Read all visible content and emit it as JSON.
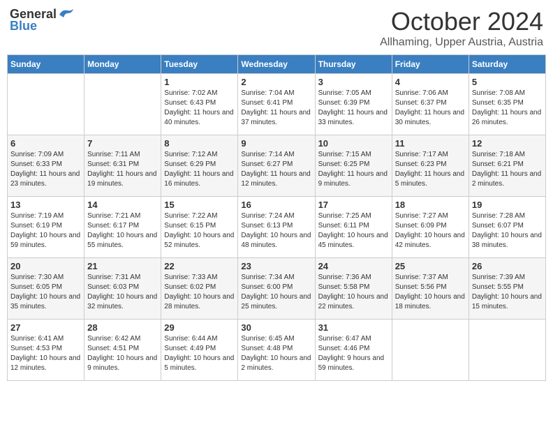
{
  "header": {
    "logo_general": "General",
    "logo_blue": "Blue",
    "title": "October 2024",
    "subtitle": "Allhaming, Upper Austria, Austria"
  },
  "days_of_week": [
    "Sunday",
    "Monday",
    "Tuesday",
    "Wednesday",
    "Thursday",
    "Friday",
    "Saturday"
  ],
  "weeks": [
    [
      {
        "num": "",
        "info": ""
      },
      {
        "num": "",
        "info": ""
      },
      {
        "num": "1",
        "info": "Sunrise: 7:02 AM\nSunset: 6:43 PM\nDaylight: 11 hours and 40 minutes."
      },
      {
        "num": "2",
        "info": "Sunrise: 7:04 AM\nSunset: 6:41 PM\nDaylight: 11 hours and 37 minutes."
      },
      {
        "num": "3",
        "info": "Sunrise: 7:05 AM\nSunset: 6:39 PM\nDaylight: 11 hours and 33 minutes."
      },
      {
        "num": "4",
        "info": "Sunrise: 7:06 AM\nSunset: 6:37 PM\nDaylight: 11 hours and 30 minutes."
      },
      {
        "num": "5",
        "info": "Sunrise: 7:08 AM\nSunset: 6:35 PM\nDaylight: 11 hours and 26 minutes."
      }
    ],
    [
      {
        "num": "6",
        "info": "Sunrise: 7:09 AM\nSunset: 6:33 PM\nDaylight: 11 hours and 23 minutes."
      },
      {
        "num": "7",
        "info": "Sunrise: 7:11 AM\nSunset: 6:31 PM\nDaylight: 11 hours and 19 minutes."
      },
      {
        "num": "8",
        "info": "Sunrise: 7:12 AM\nSunset: 6:29 PM\nDaylight: 11 hours and 16 minutes."
      },
      {
        "num": "9",
        "info": "Sunrise: 7:14 AM\nSunset: 6:27 PM\nDaylight: 11 hours and 12 minutes."
      },
      {
        "num": "10",
        "info": "Sunrise: 7:15 AM\nSunset: 6:25 PM\nDaylight: 11 hours and 9 minutes."
      },
      {
        "num": "11",
        "info": "Sunrise: 7:17 AM\nSunset: 6:23 PM\nDaylight: 11 hours and 5 minutes."
      },
      {
        "num": "12",
        "info": "Sunrise: 7:18 AM\nSunset: 6:21 PM\nDaylight: 11 hours and 2 minutes."
      }
    ],
    [
      {
        "num": "13",
        "info": "Sunrise: 7:19 AM\nSunset: 6:19 PM\nDaylight: 10 hours and 59 minutes."
      },
      {
        "num": "14",
        "info": "Sunrise: 7:21 AM\nSunset: 6:17 PM\nDaylight: 10 hours and 55 minutes."
      },
      {
        "num": "15",
        "info": "Sunrise: 7:22 AM\nSunset: 6:15 PM\nDaylight: 10 hours and 52 minutes."
      },
      {
        "num": "16",
        "info": "Sunrise: 7:24 AM\nSunset: 6:13 PM\nDaylight: 10 hours and 48 minutes."
      },
      {
        "num": "17",
        "info": "Sunrise: 7:25 AM\nSunset: 6:11 PM\nDaylight: 10 hours and 45 minutes."
      },
      {
        "num": "18",
        "info": "Sunrise: 7:27 AM\nSunset: 6:09 PM\nDaylight: 10 hours and 42 minutes."
      },
      {
        "num": "19",
        "info": "Sunrise: 7:28 AM\nSunset: 6:07 PM\nDaylight: 10 hours and 38 minutes."
      }
    ],
    [
      {
        "num": "20",
        "info": "Sunrise: 7:30 AM\nSunset: 6:05 PM\nDaylight: 10 hours and 35 minutes."
      },
      {
        "num": "21",
        "info": "Sunrise: 7:31 AM\nSunset: 6:03 PM\nDaylight: 10 hours and 32 minutes."
      },
      {
        "num": "22",
        "info": "Sunrise: 7:33 AM\nSunset: 6:02 PM\nDaylight: 10 hours and 28 minutes."
      },
      {
        "num": "23",
        "info": "Sunrise: 7:34 AM\nSunset: 6:00 PM\nDaylight: 10 hours and 25 minutes."
      },
      {
        "num": "24",
        "info": "Sunrise: 7:36 AM\nSunset: 5:58 PM\nDaylight: 10 hours and 22 minutes."
      },
      {
        "num": "25",
        "info": "Sunrise: 7:37 AM\nSunset: 5:56 PM\nDaylight: 10 hours and 18 minutes."
      },
      {
        "num": "26",
        "info": "Sunrise: 7:39 AM\nSunset: 5:55 PM\nDaylight: 10 hours and 15 minutes."
      }
    ],
    [
      {
        "num": "27",
        "info": "Sunrise: 6:41 AM\nSunset: 4:53 PM\nDaylight: 10 hours and 12 minutes."
      },
      {
        "num": "28",
        "info": "Sunrise: 6:42 AM\nSunset: 4:51 PM\nDaylight: 10 hours and 9 minutes."
      },
      {
        "num": "29",
        "info": "Sunrise: 6:44 AM\nSunset: 4:49 PM\nDaylight: 10 hours and 5 minutes."
      },
      {
        "num": "30",
        "info": "Sunrise: 6:45 AM\nSunset: 4:48 PM\nDaylight: 10 hours and 2 minutes."
      },
      {
        "num": "31",
        "info": "Sunrise: 6:47 AM\nSunset: 4:46 PM\nDaylight: 9 hours and 59 minutes."
      },
      {
        "num": "",
        "info": ""
      },
      {
        "num": "",
        "info": ""
      }
    ]
  ]
}
